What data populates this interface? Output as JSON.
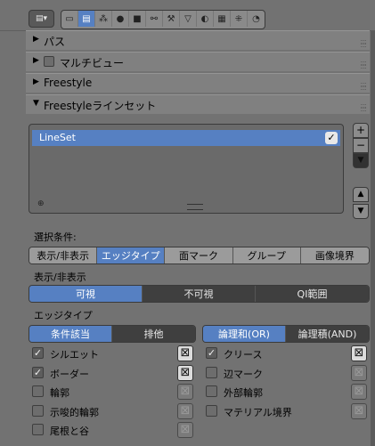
{
  "header": {
    "menu_icon": "editor-type-icon",
    "tabs": [
      {
        "icon": "render-icon",
        "glyph": "▭"
      },
      {
        "icon": "render-layers-icon",
        "glyph": "▤"
      },
      {
        "icon": "scene-icon",
        "glyph": "⁂"
      },
      {
        "icon": "world-icon",
        "glyph": "●"
      },
      {
        "icon": "object-icon",
        "glyph": "■"
      },
      {
        "icon": "constraints-icon",
        "glyph": "⚯"
      },
      {
        "icon": "modifiers-icon",
        "glyph": "⚒"
      },
      {
        "icon": "data-icon",
        "glyph": "▽"
      },
      {
        "icon": "material-icon",
        "glyph": "◐"
      },
      {
        "icon": "texture-icon",
        "glyph": "▦"
      },
      {
        "icon": "particles-icon",
        "glyph": "⁜"
      },
      {
        "icon": "physics-icon",
        "glyph": "◔"
      }
    ],
    "active_tab": 1
  },
  "panels": {
    "pass": "パス",
    "multiview": "マルチビュー",
    "freestyle": "Freestyle",
    "lineset": "Freestyleラインセット"
  },
  "lineset_list": {
    "items": [
      {
        "name": "LineSet",
        "checked": "✓"
      }
    ]
  },
  "side_buttons": {
    "add": "+",
    "remove": "−",
    "menu": "▼",
    "up": "▲",
    "down": "▼"
  },
  "selection": {
    "label": "選択条件:",
    "options": [
      "表示/非表示",
      "エッジタイプ",
      "面マーク",
      "グループ",
      "画像境界"
    ],
    "active": [
      1
    ]
  },
  "visibility": {
    "label": "表示/非表示",
    "options": [
      "可視",
      "不可視",
      "QI範囲"
    ],
    "active": 0
  },
  "edge_types": {
    "label": "エッジタイプ",
    "mode_options": [
      "条件該当",
      "排他"
    ],
    "mode_active": 0,
    "logic_options": [
      "論理和(OR)",
      "論理積(AND)"
    ],
    "logic_active": 0,
    "left": [
      {
        "label": "シルエット",
        "checked": true
      },
      {
        "label": "ボーダー",
        "checked": true
      },
      {
        "label": "輪郭",
        "checked": false
      },
      {
        "label": "示唆的輪郭",
        "checked": false
      },
      {
        "label": "尾根と谷",
        "checked": false
      }
    ],
    "right": [
      {
        "label": "クリース",
        "checked": true
      },
      {
        "label": "辺マーク",
        "checked": false
      },
      {
        "label": "外部輪郭",
        "checked": false
      },
      {
        "label": "マテリアル境界",
        "checked": false
      }
    ],
    "check_glyph": "✓",
    "exclude_glyph": "⊠"
  },
  "colors": {
    "accent": "#5680c2",
    "panel_bg": "#727272",
    "panel_header": "#808080"
  }
}
